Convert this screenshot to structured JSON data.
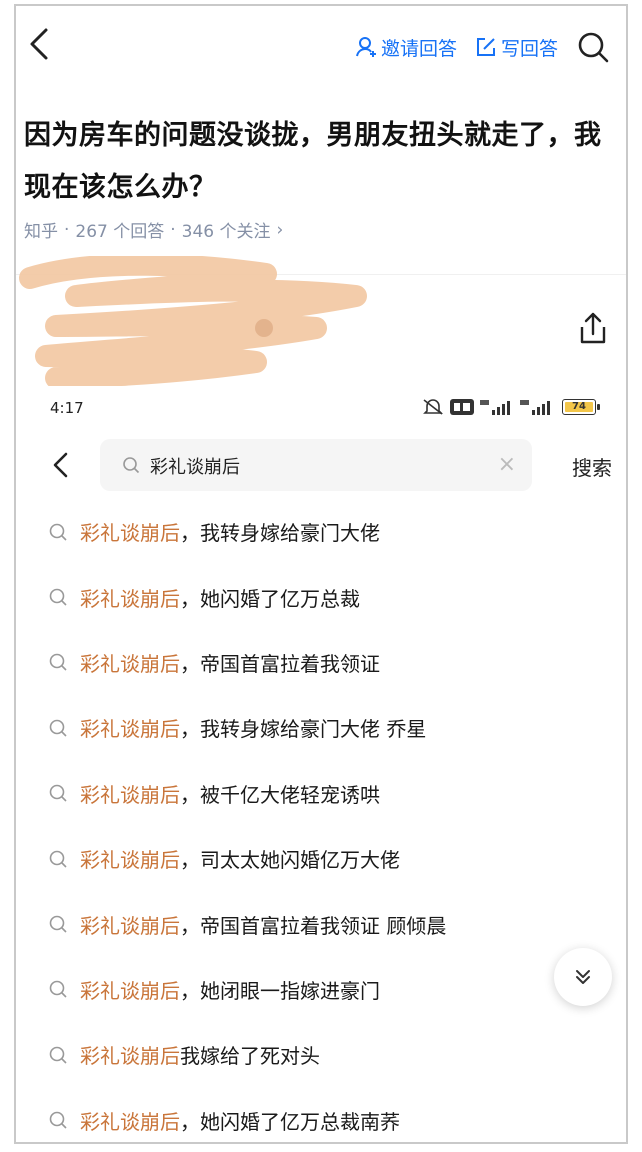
{
  "header": {
    "invite_label": "邀请回答",
    "write_label": "写回答"
  },
  "question": {
    "title": "因为房车的问题没谈拢，男朋友扭头就走了，我现在该怎么办？",
    "meta_source": "知乎",
    "meta_answers": "267 个回答",
    "meta_follows": "346 个关注",
    "meta_sep": "·",
    "meta_arrow": "›"
  },
  "phone": {
    "time": "4:17",
    "battery": "74"
  },
  "search": {
    "query": "彩礼谈崩后",
    "clear": "×",
    "submit": "搜索"
  },
  "suggestions": [
    {
      "hl": "彩礼谈崩后",
      "rest": "，我转身嫁给豪门大佬"
    },
    {
      "hl": "彩礼谈崩后",
      "rest": "，她闪婚了亿万总裁"
    },
    {
      "hl": "彩礼谈崩后",
      "rest": "，帝国首富拉着我领证"
    },
    {
      "hl": "彩礼谈崩后",
      "rest": "，我转身嫁给豪门大佬 乔星"
    },
    {
      "hl": "彩礼谈崩后",
      "rest": "，被千亿大佬轻宠诱哄"
    },
    {
      "hl": "彩礼谈崩后",
      "rest": "，司太太她闪婚亿万大佬"
    },
    {
      "hl": "彩礼谈崩后",
      "rest": "，帝国首富拉着我领证 顾倾晨"
    },
    {
      "hl": "彩礼谈崩后",
      "rest": "，她闭眼一指嫁进豪门"
    },
    {
      "hl": "彩礼谈崩后",
      "rest": "我嫁给了死对头"
    },
    {
      "hl": "彩礼谈崩后",
      "rest": "，她闪婚了亿万总裁南荞"
    }
  ],
  "colors": {
    "brand": "#1772f6",
    "highlight": "#c9753a",
    "meta": "#8590a6"
  }
}
